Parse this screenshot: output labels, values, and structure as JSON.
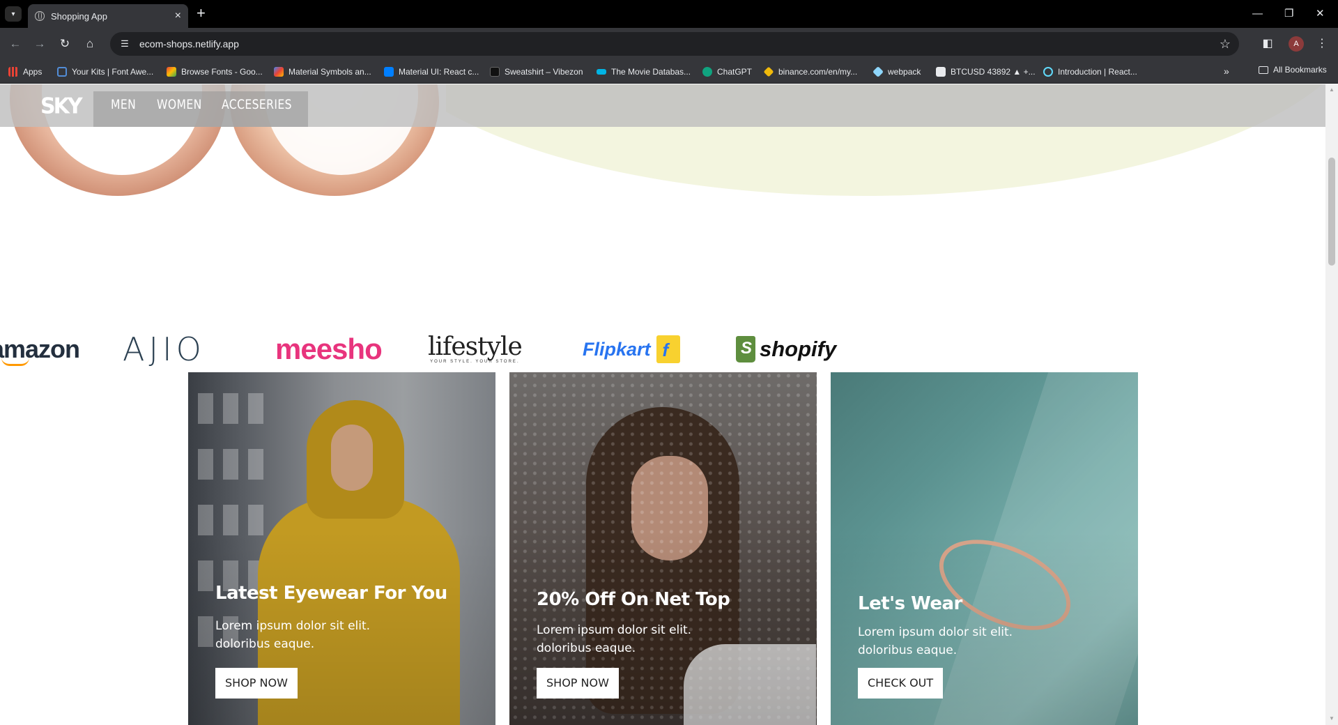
{
  "browser": {
    "tab_title": "Shopping App",
    "url": "ecom-shops.netlify.app",
    "avatar_letter": "A",
    "bookmarks": [
      {
        "label": "Apps",
        "color": "#4285f4"
      },
      {
        "label": "Your Kits | Font Awe...",
        "color": "#528dd7"
      },
      {
        "label": "Browse Fonts - Goo...",
        "color": "#ea4335"
      },
      {
        "label": "Material Symbols an...",
        "color": "#fbbc04"
      },
      {
        "label": "Material UI: React c...",
        "color": "#007fff"
      },
      {
        "label": "Sweatshirt – Vibezon",
        "color": "#111111"
      },
      {
        "label": "The Movie Databas...",
        "color": "#0d253f"
      },
      {
        "label": "ChatGPT",
        "color": "#10a37f"
      },
      {
        "label": "binance.com/en/my...",
        "color": "#f0b90b"
      },
      {
        "label": "webpack",
        "color": "#8ed6fb"
      },
      {
        "label": "BTCUSD 43892 ▲ +...",
        "color": "#131722"
      },
      {
        "label": "Introduction | React...",
        "color": "#61dafb"
      }
    ],
    "all_bookmarks_label": "All Bookmarks"
  },
  "site": {
    "logo": "SKY",
    "nav": [
      "MEN",
      "WOMEN",
      "ACCESERIES"
    ]
  },
  "brands": {
    "amazon": "amazon",
    "ajio": "AJIO",
    "meesho": "meesho",
    "lifestyle": "lifestyle",
    "lifestyle_tagline": "YOUR STYLE. YOUR STORE.",
    "flipkart": "Flipkart",
    "shopify": "shopify"
  },
  "cards": [
    {
      "title": "Latest Eyewear For You",
      "text": "Lorem ipsum dolor sit elit. doloribus eaque.",
      "button": "SHOP NOW"
    },
    {
      "title": "20% Off On Net Top",
      "text": "Lorem ipsum dolor sit elit. doloribus eaque.",
      "button": "SHOP NOW"
    },
    {
      "title": "Let's Wear",
      "text": "Lorem ipsum dolor sit elit. doloribus eaque.",
      "button": "CHECK OUT"
    }
  ]
}
